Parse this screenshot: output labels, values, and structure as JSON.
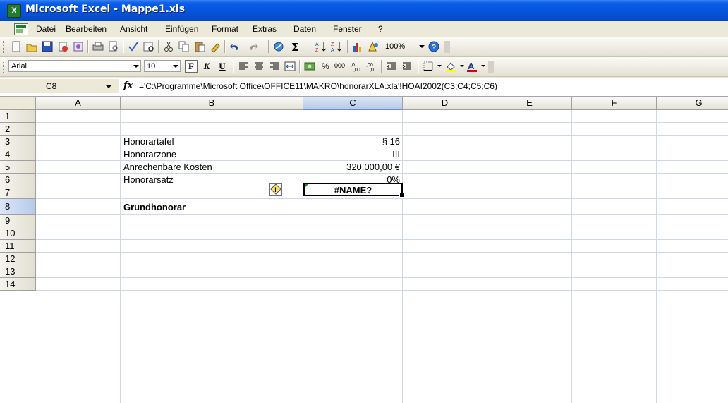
{
  "window": {
    "title": "Microsoft Excel - Mappe1.xls"
  },
  "menubar": {
    "items": [
      "Datei",
      "Bearbeiten",
      "Ansicht",
      "Einfügen",
      "Format",
      "Extras",
      "Daten",
      "Fenster",
      "?"
    ]
  },
  "toolbar_standard": {
    "zoom": "100%"
  },
  "toolbar_format": {
    "font_name": "Arial",
    "font_size": "10",
    "bold_label": "F",
    "italic_label": "K",
    "underline_label": "U",
    "percent_label": "%",
    "thousands_label": "000"
  },
  "formula_bar": {
    "name_box": "C8",
    "fx_label": "fx",
    "formula": "='C:\\Programme\\Microsoft Office\\OFFICE11\\MAKRO\\honorarXLA.xla'!HOAI2002(C3;C4;C5;C6)"
  },
  "sheet": {
    "columns": [
      "A",
      "B",
      "C",
      "D",
      "E",
      "F",
      "G"
    ],
    "selected_column": "C",
    "rows": [
      "1",
      "2",
      "3",
      "4",
      "5",
      "6",
      "7",
      "8",
      "9",
      "10",
      "11",
      "12",
      "13",
      "14"
    ],
    "selected_row": "8",
    "cells": {
      "B3": "Honorartafel",
      "C3": "§ 16",
      "B4": "Honorarzone",
      "C4": "III",
      "B5": "Anrechenbare Kosten",
      "C5": "320.000,00 €",
      "B6": "Honorarsatz",
      "C6": "0%",
      "B8": "Grundhonorar",
      "C8": "#NAME?"
    }
  },
  "colors": {
    "titlebar": "#0653d9",
    "selected_header": "#b6cbea",
    "gridline": "#d0d7e5",
    "error_indicator": "#0b8a3a"
  },
  "icons": [
    "excel-app-icon",
    "new-icon",
    "open-icon",
    "save-icon",
    "permission-icon",
    "email-icon",
    "print-icon",
    "print-preview-icon",
    "spelling-icon",
    "research-icon",
    "cut-icon",
    "copy-icon",
    "paste-icon",
    "format-painter-icon",
    "undo-icon",
    "redo-icon",
    "hyperlink-icon",
    "autosum-icon",
    "sort-ascending-icon",
    "sort-descending-icon",
    "chart-wizard-icon",
    "drawing-icon",
    "help-icon",
    "error-smarttag-icon"
  ]
}
